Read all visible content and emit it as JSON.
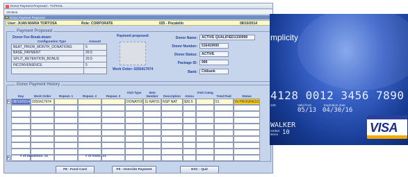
{
  "window": {
    "title": "Donor Payment Proposed - TCPHOL",
    "menu": "Ventana",
    "frame_title": "Donor Payment Proposed"
  },
  "infobar": {
    "user": "User: JUAN MARIA TORTOSA",
    "role": "Role: CORPORATE",
    "site": "025 - Pocatello",
    "date": "08/10/2014"
  },
  "proposed": {
    "group_title": "Payment Proposed",
    "fee_heading": "Donor Fee Break-down:",
    "col_config": "Configuration Type",
    "col_amount": "Amount",
    "fees": [
      {
        "type": "BEAT_PRIOR_MONTH_DONATIONS",
        "amount": "5"
      },
      {
        "type": "BASE_PAYMENT",
        "amount": "20.5"
      },
      {
        "type": "SPLIT_RETENTION_BONUS",
        "amount": "20.5"
      },
      {
        "type": "INCONVENIENCE",
        "amount": "5"
      },
      {
        "type": "",
        "amount": ""
      }
    ],
    "payment_label": "Payment proposed:",
    "work_order": "Work Order: 0250417974",
    "donor_name_label": "Donor Name:",
    "donor_name": "ACTIVE QUALIFIED1330999",
    "donor_number_label": "Donor Number:",
    "donor_number": "516419000",
    "donor_status_label": "Donor Status:",
    "donor_status": "ACTIVE",
    "package_label": "Package ID:",
    "package_id": "999",
    "bank_label": "Bank:",
    "bank": "Citibank"
  },
  "history": {
    "group_title": "Donor Payment History",
    "columns": [
      "Day",
      "Work Order",
      "Repeat. 1",
      "Repeat. 2",
      "Repeat. 3",
      "Visit Type",
      "Item Number",
      "Description",
      "Amou",
      "Visit Categ",
      "Total Paid",
      "Status"
    ],
    "rows": [
      [
        "08/10/2014",
        "0250417974",
        "",
        "",
        "",
        "DONATION",
        "11-NAT01",
        "NSP NAT",
        "$30.5",
        "",
        "51",
        "IN PROGRESS"
      ]
    ],
    "donations": "# of Donations: 13",
    "visits": "# of Visits: 13"
  },
  "buttons": {
    "fund": "F8 - Fund Card",
    "override": "F9 - Override Payment",
    "quit": "ESC - Quit"
  },
  "card": {
    "brand": "mplicity",
    "number": "4128 0012 3456 7890",
    "prefix": "128",
    "valid_from_label": "Valid from",
    "valid_from": "05/13",
    "expiration_label": "Expiration date",
    "expiration": "04/30/16",
    "name": "WALKER",
    "member_label": "ember",
    "since_label": "since",
    "since": "10",
    "network": "VISA"
  }
}
